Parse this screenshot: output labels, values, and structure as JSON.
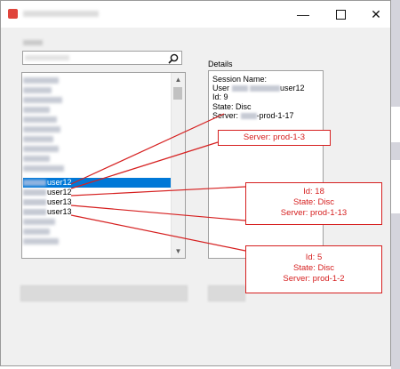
{
  "details": {
    "label": "Details",
    "session_name_label": "Session Name:",
    "user_prefix": "User",
    "user_suffix": "user12",
    "id_line": "Id: 9",
    "state_line": "State: Disc",
    "server_prefix": "Server:",
    "server_suffix": "-prod-1-17"
  },
  "list": {
    "rows": [
      {
        "suffix": "user12",
        "selected": true
      },
      {
        "suffix": "user12",
        "selected": false
      },
      {
        "suffix": "user13",
        "selected": false
      },
      {
        "suffix": "user13",
        "selected": false
      }
    ]
  },
  "callouts": {
    "c1": {
      "line1": "Server: prod-1-3"
    },
    "c2": {
      "line1": "Id: 18",
      "line2": "State: Disc",
      "line3": "Server: prod-1-13"
    },
    "c3": {
      "line1": "Id: 5",
      "line2": "State: Disc",
      "line3": "Server: prod-1-2"
    }
  },
  "colors": {
    "accent": "#0078d7",
    "annotation": "#d62020"
  },
  "icons": {
    "search": "search-icon",
    "minimize": "minimize-icon",
    "maximize": "maximize-icon",
    "close": "close-icon"
  }
}
